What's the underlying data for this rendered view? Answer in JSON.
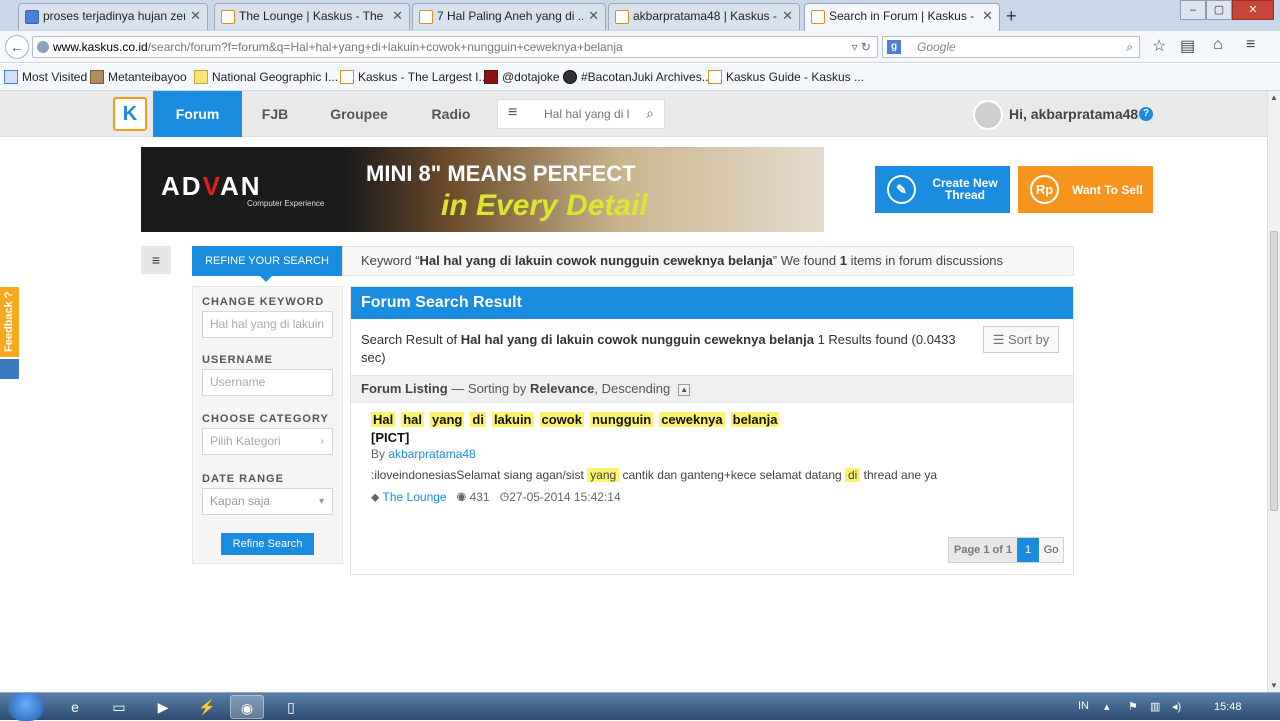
{
  "browser": {
    "tabs": [
      {
        "label": "proses terjadinya hujan zen...",
        "active": false,
        "icon": "google-favicon"
      },
      {
        "label": "The Lounge | Kaskus - The ...",
        "active": false,
        "icon": "kaskus-favicon"
      },
      {
        "label": "7 Hal Paling Aneh yang di ...",
        "active": false,
        "icon": "kaskus-favicon"
      },
      {
        "label": "akbarpratama48 | Kaskus - ...",
        "active": false,
        "icon": "kaskus-favicon"
      },
      {
        "label": "Search in Forum | Kaskus - ...",
        "active": true,
        "icon": "kaskus-favicon"
      }
    ],
    "url_host": "www.kaskus.co.id",
    "url_path": "/search/forum?f=forum&q=Hal+hal+yang+di+lakuin+cowok+nungguin+ceweknya+belanja",
    "search_engine": "Google",
    "bookmarks": [
      "Most Visited",
      "Metanteibayoo",
      "National Geographic I...",
      "Kaskus - The Largest I...",
      "@dotajoke",
      "#BacotanJuki Archives...",
      "Kaskus Guide - Kaskus ..."
    ]
  },
  "kaskus": {
    "nav": [
      "Forum",
      "FJB",
      "Groupee",
      "Radio"
    ],
    "search_placeholder": "Hal hal yang di l",
    "greeting": "Hi, akbarpratama48",
    "help": "?",
    "banner": {
      "brand_a": "AD",
      "brand_v": "V",
      "brand_b": "AN",
      "tagline": "Computer Experience",
      "headline": "MINI 8\" MEANS PERFECT",
      "subline": "in Every Detail"
    },
    "create_thread": "Create New Thread",
    "want_to_sell": "Want To Sell",
    "rp": "Rp"
  },
  "refine": {
    "tab": "REFINE YOUR SEARCH",
    "kw_prefix": "Keyword “",
    "kw": "Hal hal yang di lakuin cowok nungguin ceweknya belanja",
    "kw_mid": "” We found ",
    "count": "1",
    "kw_suffix": " items in forum discussions"
  },
  "sidebar": {
    "change_keyword": "CHANGE KEYWORD",
    "keyword_value": "Hal hal yang di lakuin",
    "username": "USERNAME",
    "username_placeholder": "Username",
    "category": "CHOOSE CATEGORY",
    "category_placeholder": "Pilih Kategori",
    "date_range": "DATE RANGE",
    "date_value": "Kapan saja",
    "button": "Refine Search"
  },
  "results": {
    "header": "Forum Search Result",
    "summary_prefix": "Search Result of ",
    "summary_query": "Hal hal yang di lakuin cowok nungguin ceweknya belanja",
    "summary_suffix": " 1 Results found (0.0433 sec)",
    "sort": "Sort by",
    "listing_label": "Forum Listing",
    "listing_mid": " — Sorting by ",
    "listing_sort": "Relevance",
    "listing_order": ", Descending",
    "item": {
      "title_words": [
        "Hal",
        "hal",
        "yang",
        "di",
        "lakuin",
        "cowok",
        "nungguin",
        "ceweknya",
        "belanja"
      ],
      "pict": "[PICT]",
      "by": "By ",
      "author": "akbarpratama48",
      "snippet_a": ":iloveindonesiasSelamat siang agan/sist ",
      "snippet_hl1": "yang",
      "snippet_b": " cantik dan ganteng+kece selamat datang ",
      "snippet_hl2": "di",
      "snippet_c": " thread ane ya",
      "category": "The Lounge",
      "views": "431",
      "date": "27-05-2014 15:42:14"
    },
    "pager": {
      "info": "Page 1 of 1",
      "current": "1",
      "go": "Go"
    }
  },
  "feedback": "Feedback ?",
  "taskbar": {
    "lang": "IN",
    "time": "15:48"
  }
}
